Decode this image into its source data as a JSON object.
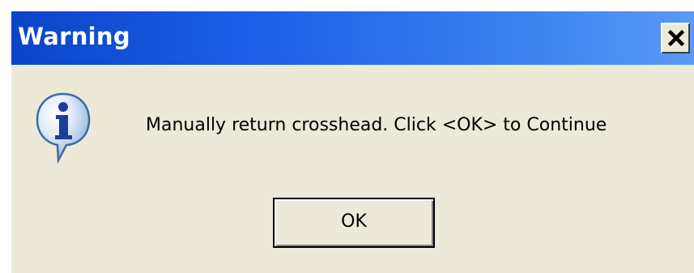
{
  "window": {
    "title": "Warning",
    "close_icon": "close-icon"
  },
  "body": {
    "icon": "info-icon",
    "message": "Manually return crosshead. Click <OK> to Continue"
  },
  "buttons": {
    "ok_label": "OK"
  }
}
